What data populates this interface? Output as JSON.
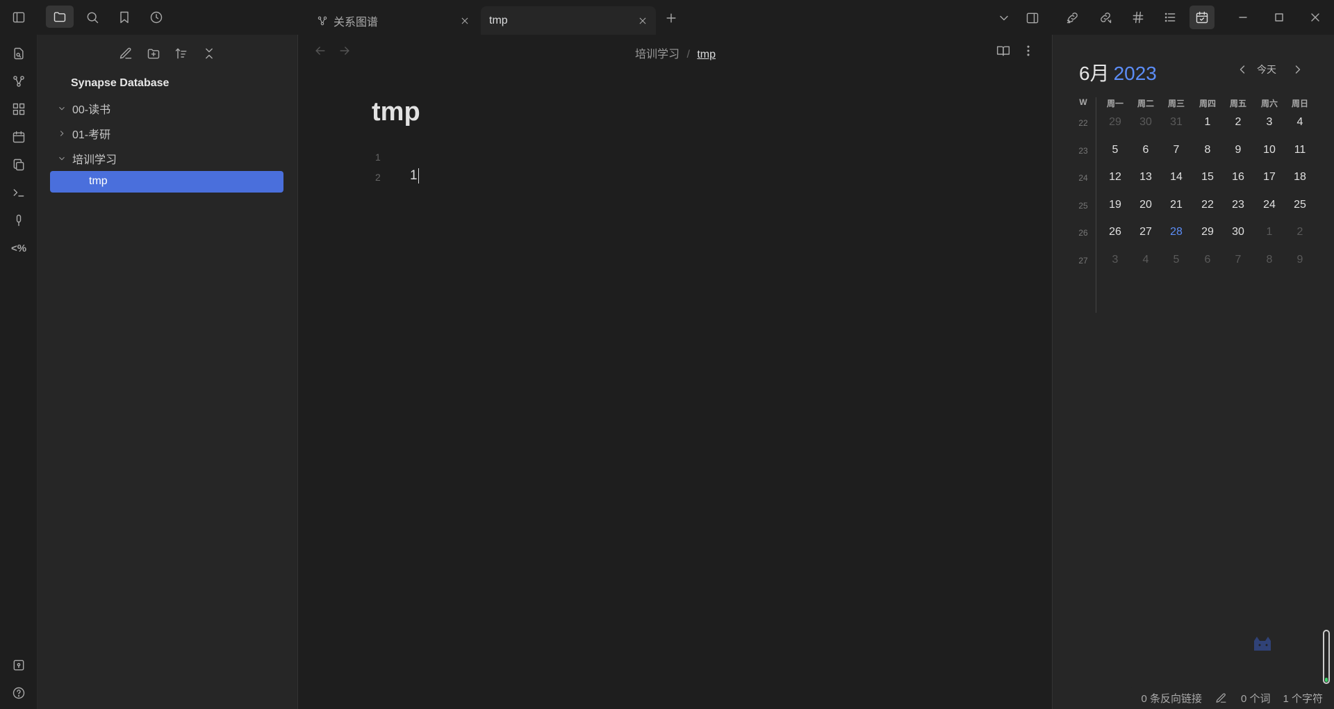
{
  "tabs": [
    {
      "label": "关系图谱",
      "active": false
    },
    {
      "label": "tmp",
      "active": true
    }
  ],
  "sidebar": {
    "vault_name": "Synapse Database",
    "items": [
      {
        "label": "00-读书",
        "expanded": true
      },
      {
        "label": "01-考研",
        "expanded": false
      },
      {
        "label": "培训学习",
        "expanded": true
      },
      {
        "label": "tmp",
        "selected": true
      }
    ]
  },
  "breadcrumb": {
    "parent": "培训学习",
    "separator": "/",
    "current": "tmp"
  },
  "editor": {
    "title": "tmp",
    "lines": [
      {
        "num": "1",
        "text": ""
      },
      {
        "num": "2",
        "text": "1"
      }
    ]
  },
  "calendar": {
    "month": "6月",
    "year": "2023",
    "today_label": "今天",
    "week_header": "W",
    "weekdays": [
      "周一",
      "周二",
      "周三",
      "周四",
      "周五",
      "周六",
      "周日"
    ],
    "weeks": [
      {
        "num": "22",
        "days": [
          {
            "d": "29",
            "dim": true
          },
          {
            "d": "30",
            "dim": true
          },
          {
            "d": "31",
            "dim": true
          },
          {
            "d": "1"
          },
          {
            "d": "2"
          },
          {
            "d": "3"
          },
          {
            "d": "4"
          }
        ]
      },
      {
        "num": "23",
        "days": [
          {
            "d": "5"
          },
          {
            "d": "6"
          },
          {
            "d": "7"
          },
          {
            "d": "8"
          },
          {
            "d": "9"
          },
          {
            "d": "10"
          },
          {
            "d": "11"
          }
        ]
      },
      {
        "num": "24",
        "days": [
          {
            "d": "12"
          },
          {
            "d": "13"
          },
          {
            "d": "14"
          },
          {
            "d": "15"
          },
          {
            "d": "16"
          },
          {
            "d": "17"
          },
          {
            "d": "18"
          }
        ]
      },
      {
        "num": "25",
        "days": [
          {
            "d": "19"
          },
          {
            "d": "20"
          },
          {
            "d": "21"
          },
          {
            "d": "22"
          },
          {
            "d": "23"
          },
          {
            "d": "24"
          },
          {
            "d": "25"
          }
        ]
      },
      {
        "num": "26",
        "days": [
          {
            "d": "26"
          },
          {
            "d": "27"
          },
          {
            "d": "28",
            "today": true
          },
          {
            "d": "29"
          },
          {
            "d": "30"
          },
          {
            "d": "1",
            "dim": true
          },
          {
            "d": "2",
            "dim": true
          }
        ]
      },
      {
        "num": "27",
        "days": [
          {
            "d": "3",
            "dim": true
          },
          {
            "d": "4",
            "dim": true
          },
          {
            "d": "5",
            "dim": true
          },
          {
            "d": "6",
            "dim": true
          },
          {
            "d": "7",
            "dim": true
          },
          {
            "d": "8",
            "dim": true
          },
          {
            "d": "9",
            "dim": true
          }
        ]
      }
    ]
  },
  "status_bar": {
    "backlinks": "0 条反向链接",
    "words": "0 个词",
    "chars": "1 个字符"
  },
  "colors": {
    "accent": "#4a6fdc",
    "accent_text": "#5c8df6",
    "background": "#1e1e1e",
    "panel": "#262626"
  }
}
